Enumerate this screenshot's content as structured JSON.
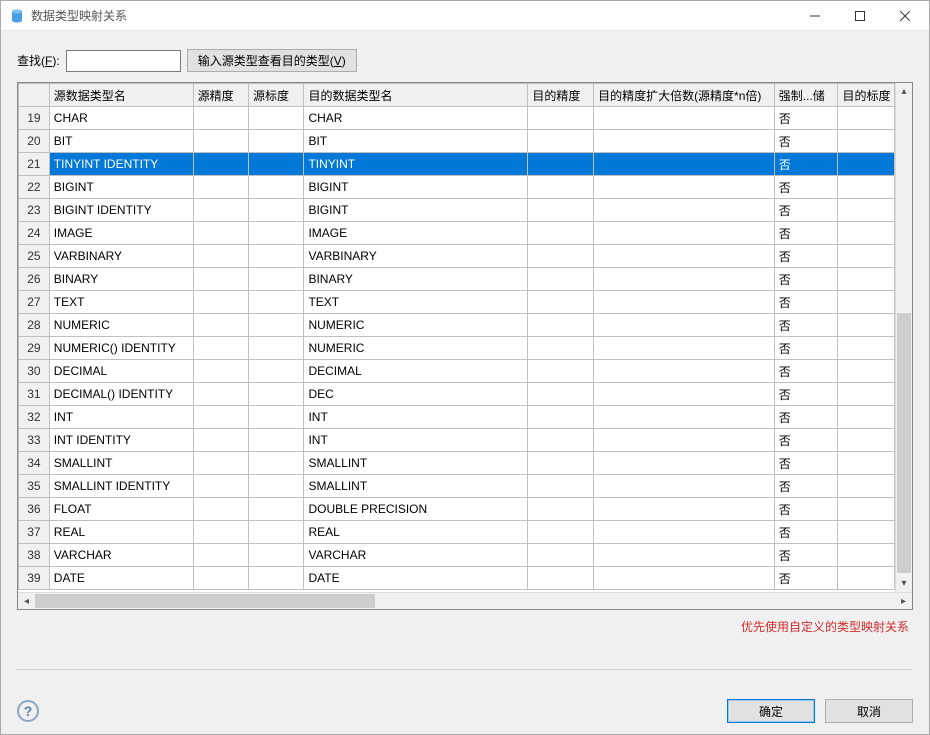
{
  "window": {
    "title": "数据类型映射关系"
  },
  "search": {
    "label_prefix": "查找(",
    "label_accel": "F",
    "label_suffix": "):",
    "input_value": "",
    "button_prefix": "输入源类型查看目的类型(",
    "button_accel": "V",
    "button_suffix": ")"
  },
  "columns": {
    "src_name": "源数据类型名",
    "src_prec": "源精度",
    "src_scale": "源标度",
    "dst_name": "目的数据类型名",
    "dst_prec": "目的精度",
    "mult_n": "目的精度扩大倍数(源精度*n倍)",
    "force": "强制...储",
    "dst_scale": "目的标度"
  },
  "hint": "优先使用自定义的类型映射关系",
  "buttons": {
    "ok": "确定",
    "cancel": "取消"
  },
  "selected_row_index": 2,
  "rows": [
    {
      "n": 19,
      "src": "CHAR",
      "srcprec": "",
      "srcscale": "",
      "dst": "CHAR",
      "dstprec": "",
      "multn": "",
      "force": "否",
      "dstscale": ""
    },
    {
      "n": 20,
      "src": "BIT",
      "srcprec": "",
      "srcscale": "",
      "dst": "BIT",
      "dstprec": "",
      "multn": "",
      "force": "否",
      "dstscale": ""
    },
    {
      "n": 21,
      "src": "TINYINT IDENTITY",
      "srcprec": "",
      "srcscale": "",
      "dst": "TINYINT",
      "dstprec": "",
      "multn": "",
      "force": "否",
      "dstscale": ""
    },
    {
      "n": 22,
      "src": "BIGINT",
      "srcprec": "",
      "srcscale": "",
      "dst": "BIGINT",
      "dstprec": "",
      "multn": "",
      "force": "否",
      "dstscale": ""
    },
    {
      "n": 23,
      "src": "BIGINT IDENTITY",
      "srcprec": "",
      "srcscale": "",
      "dst": "BIGINT",
      "dstprec": "",
      "multn": "",
      "force": "否",
      "dstscale": ""
    },
    {
      "n": 24,
      "src": "IMAGE",
      "srcprec": "",
      "srcscale": "",
      "dst": "IMAGE",
      "dstprec": "",
      "multn": "",
      "force": "否",
      "dstscale": ""
    },
    {
      "n": 25,
      "src": "VARBINARY",
      "srcprec": "",
      "srcscale": "",
      "dst": "VARBINARY",
      "dstprec": "",
      "multn": "",
      "force": "否",
      "dstscale": ""
    },
    {
      "n": 26,
      "src": "BINARY",
      "srcprec": "",
      "srcscale": "",
      "dst": "BINARY",
      "dstprec": "",
      "multn": "",
      "force": "否",
      "dstscale": ""
    },
    {
      "n": 27,
      "src": "TEXT",
      "srcprec": "",
      "srcscale": "",
      "dst": "TEXT",
      "dstprec": "",
      "multn": "",
      "force": "否",
      "dstscale": ""
    },
    {
      "n": 28,
      "src": "NUMERIC",
      "srcprec": "",
      "srcscale": "",
      "dst": "NUMERIC",
      "dstprec": "",
      "multn": "",
      "force": "否",
      "dstscale": ""
    },
    {
      "n": 29,
      "src": "NUMERIC() IDENTITY",
      "srcprec": "",
      "srcscale": "",
      "dst": "NUMERIC",
      "dstprec": "",
      "multn": "",
      "force": "否",
      "dstscale": ""
    },
    {
      "n": 30,
      "src": "DECIMAL",
      "srcprec": "",
      "srcscale": "",
      "dst": "DECIMAL",
      "dstprec": "",
      "multn": "",
      "force": "否",
      "dstscale": ""
    },
    {
      "n": 31,
      "src": "DECIMAL() IDENTITY",
      "srcprec": "",
      "srcscale": "",
      "dst": "DEC",
      "dstprec": "",
      "multn": "",
      "force": "否",
      "dstscale": ""
    },
    {
      "n": 32,
      "src": "INT",
      "srcprec": "",
      "srcscale": "",
      "dst": "INT",
      "dstprec": "",
      "multn": "",
      "force": "否",
      "dstscale": ""
    },
    {
      "n": 33,
      "src": "INT IDENTITY",
      "srcprec": "",
      "srcscale": "",
      "dst": "INT",
      "dstprec": "",
      "multn": "",
      "force": "否",
      "dstscale": ""
    },
    {
      "n": 34,
      "src": "SMALLINT",
      "srcprec": "",
      "srcscale": "",
      "dst": "SMALLINT",
      "dstprec": "",
      "multn": "",
      "force": "否",
      "dstscale": ""
    },
    {
      "n": 35,
      "src": "SMALLINT IDENTITY",
      "srcprec": "",
      "srcscale": "",
      "dst": "SMALLINT",
      "dstprec": "",
      "multn": "",
      "force": "否",
      "dstscale": ""
    },
    {
      "n": 36,
      "src": "FLOAT",
      "srcprec": "",
      "srcscale": "",
      "dst": "DOUBLE PRECISION",
      "dstprec": "",
      "multn": "",
      "force": "否",
      "dstscale": ""
    },
    {
      "n": 37,
      "src": "REAL",
      "srcprec": "",
      "srcscale": "",
      "dst": "REAL",
      "dstprec": "",
      "multn": "",
      "force": "否",
      "dstscale": ""
    },
    {
      "n": 38,
      "src": "VARCHAR",
      "srcprec": "",
      "srcscale": "",
      "dst": "VARCHAR",
      "dstprec": "",
      "multn": "",
      "force": "否",
      "dstscale": ""
    },
    {
      "n": 39,
      "src": "DATE",
      "srcprec": "",
      "srcscale": "",
      "dst": "DATE",
      "dstprec": "",
      "multn": "",
      "force": "否",
      "dstscale": ""
    }
  ]
}
